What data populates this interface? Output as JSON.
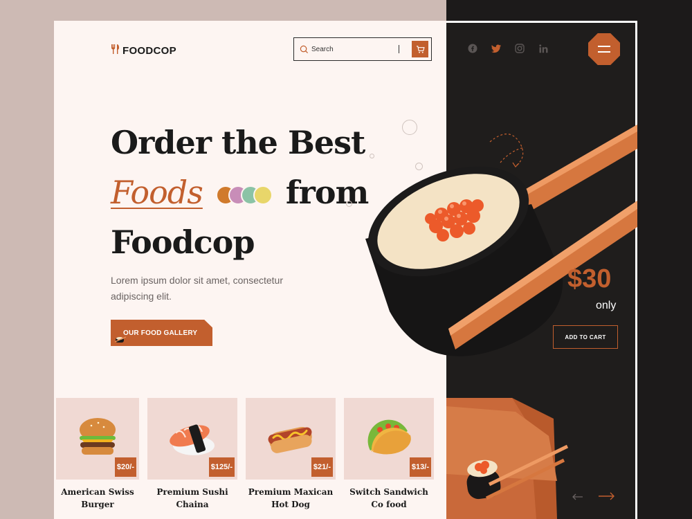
{
  "brand": {
    "name": "FOODCOP",
    "logo_icon": "fork-knife-icon",
    "accent": "#c25f2e"
  },
  "search": {
    "placeholder": "Search"
  },
  "social": [
    "facebook-icon",
    "twitter-icon",
    "instagram-icon",
    "linkedin-icon"
  ],
  "hero": {
    "line1": "Order the Best",
    "highlight": "Foods",
    "line2_rest": "from",
    "line3": "Foodcop",
    "description": "Lorem ipsum dolor sit amet, consectetur adipiscing elit.",
    "cta": "OUR FOOD GALLERY"
  },
  "feature": {
    "price": "$30",
    "suffix": "only",
    "cta": "ADD TO CART"
  },
  "products": [
    {
      "name_line1": "American Swiss",
      "name_line2": "Burger",
      "price": "$20/-"
    },
    {
      "name_line1": "Premium Sushi",
      "name_line2": "Chaina",
      "price": "$125/-"
    },
    {
      "name_line1": "Premium Maxican",
      "name_line2": "Hot Dog",
      "price": "$21/-"
    },
    {
      "name_line1": "Switch  Sandwich",
      "name_line2": "Co food",
      "price": "$13/-"
    }
  ]
}
